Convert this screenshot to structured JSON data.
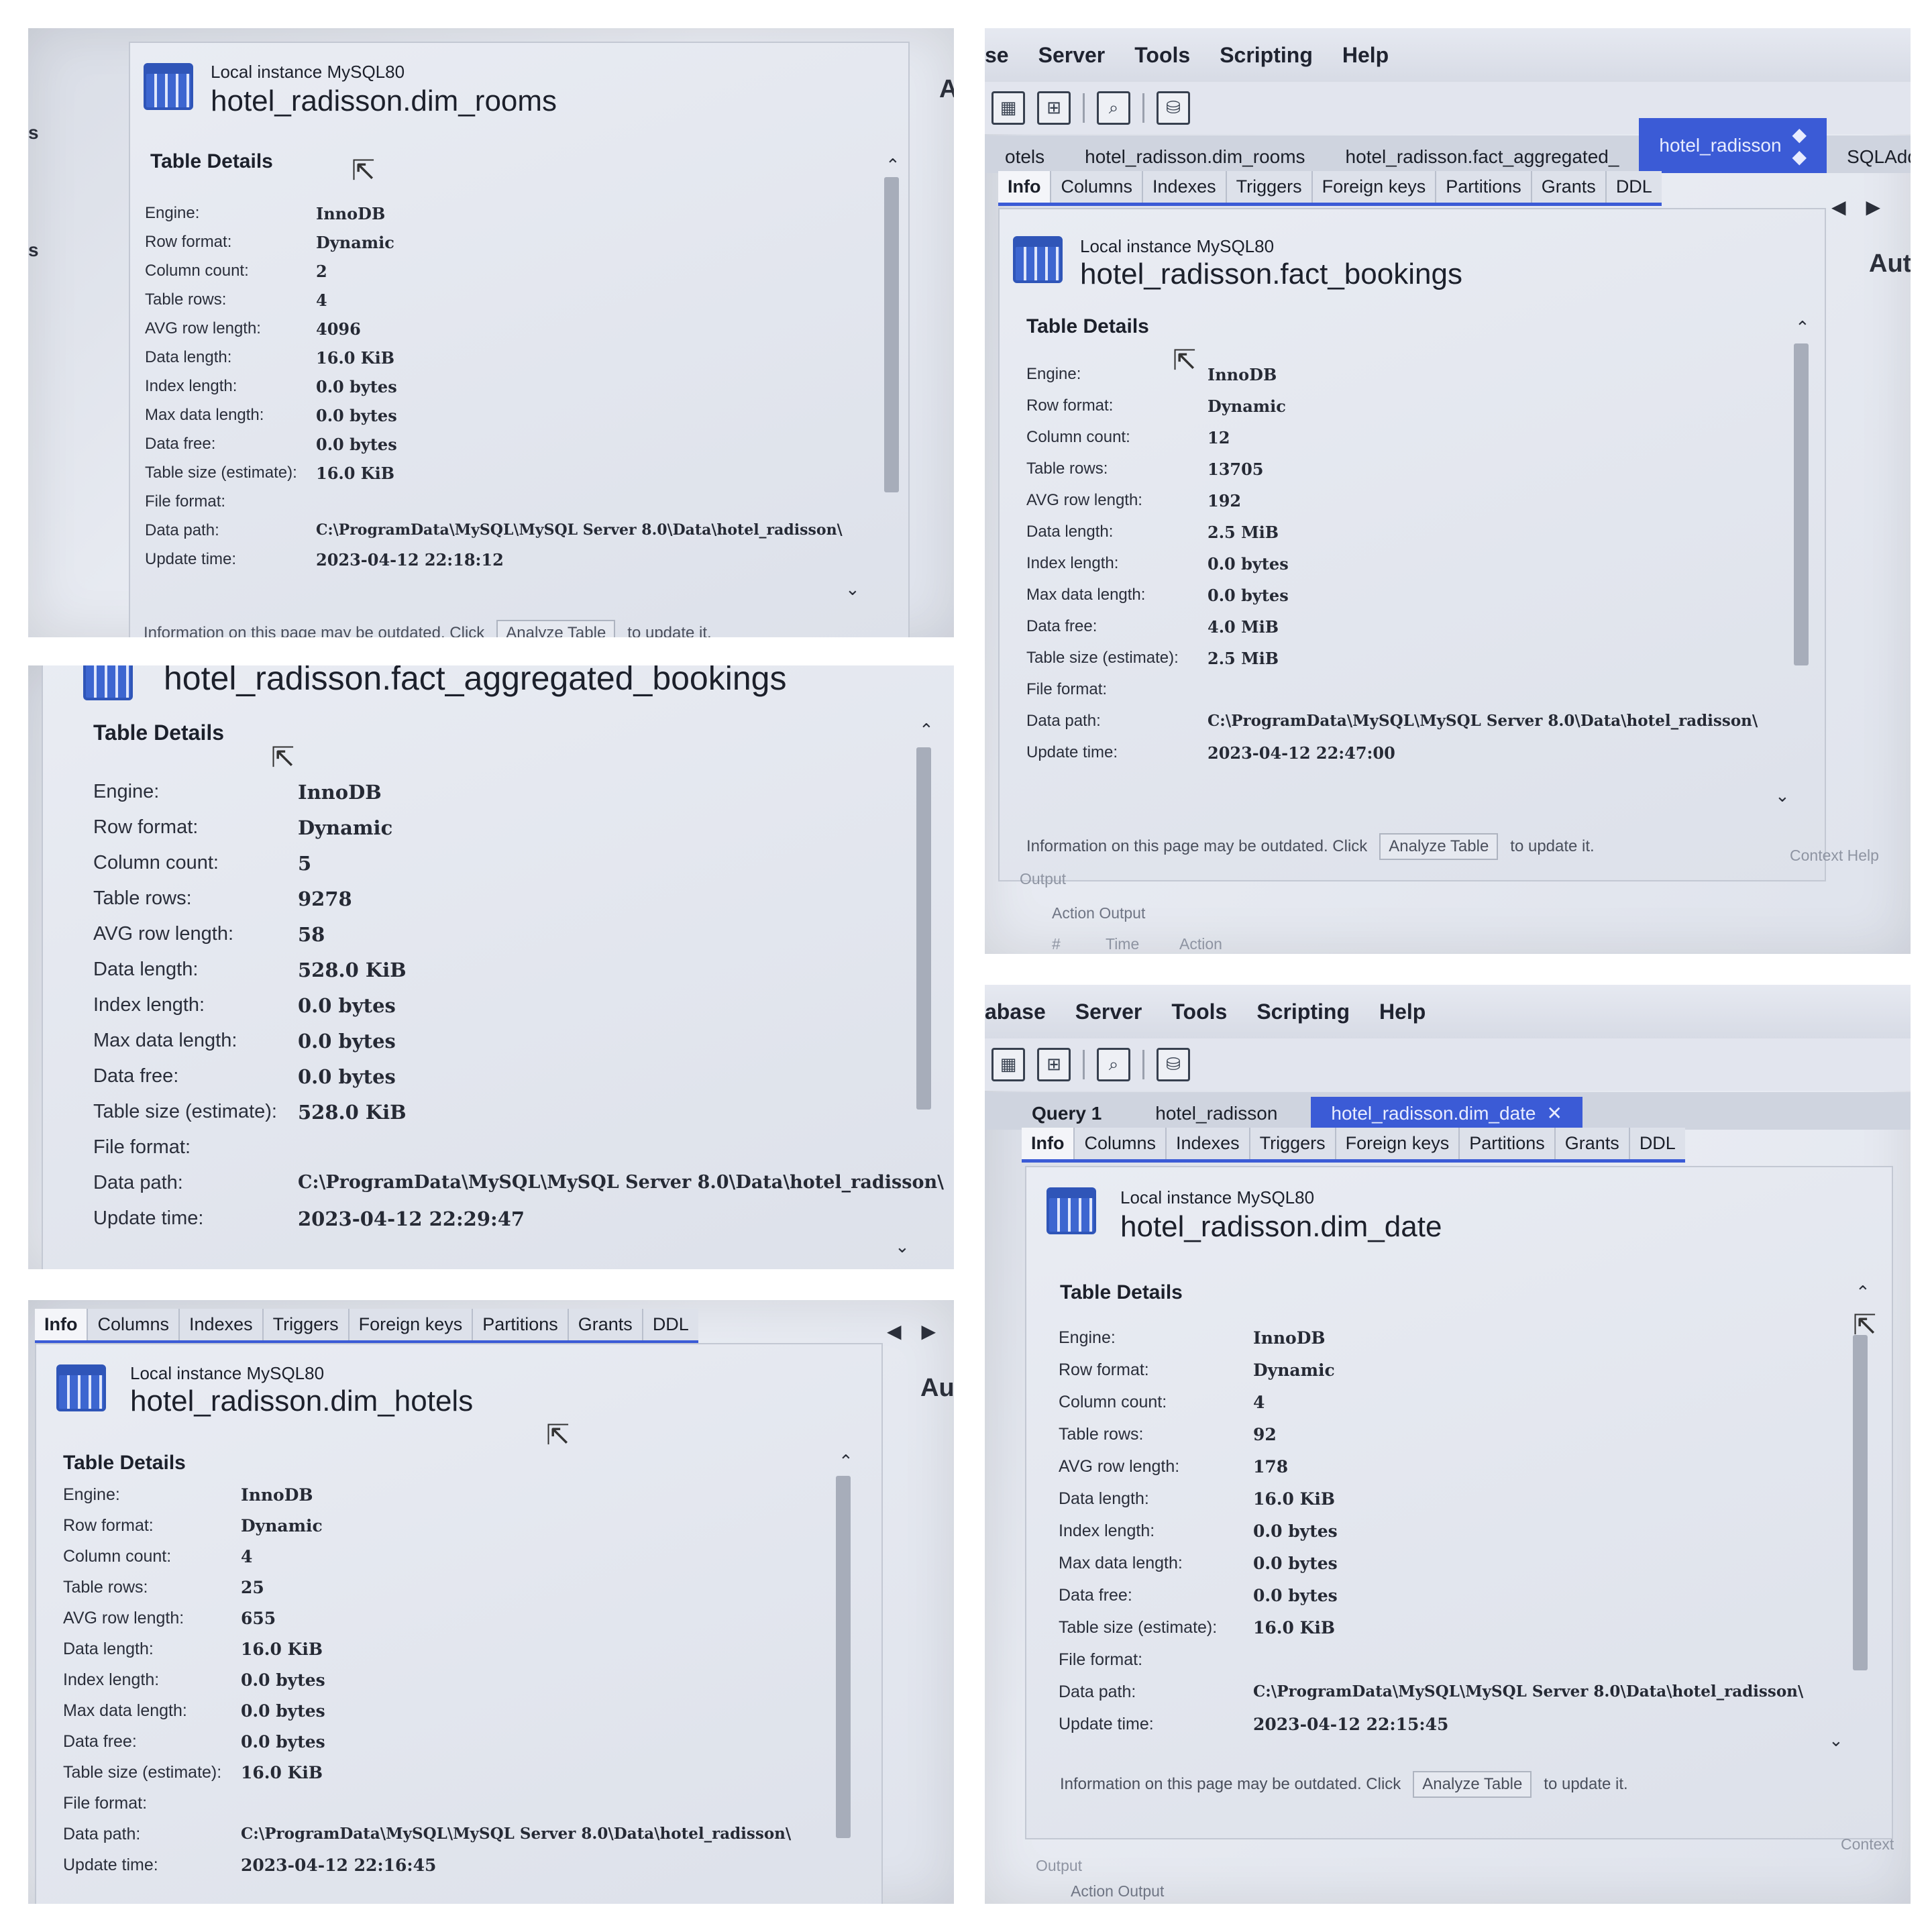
{
  "common": {
    "instance_label": "Local instance MySQL80",
    "section_title": "Table Details",
    "labels": {
      "engine": "Engine:",
      "row_format": "Row format:",
      "column_count": "Column count:",
      "table_rows": "Table rows:",
      "avg_row_length": "AVG row length:",
      "data_length": "Data length:",
      "index_length": "Index length:",
      "max_data_length": "Max data length:",
      "data_free": "Data free:",
      "table_size": "Table size (estimate):",
      "file_format": "File format:",
      "data_path": "Data path:",
      "update_time": "Update time:"
    },
    "footer_text": "Information on this page may be outdated. Click",
    "analyze_button": "Analyze Table",
    "footer_suffix": "to update it.",
    "output_label": "Output",
    "action_output": "Action Output",
    "menu": {
      "database_partial": "abase",
      "database_partial_b": "se",
      "server": "Server",
      "tools": "Tools",
      "scripting": "Scripting",
      "help": "Help"
    },
    "subtabs": [
      "Info",
      "Columns",
      "Indexes",
      "Triggers",
      "Foreign keys",
      "Partitions",
      "Grants",
      "DDL"
    ],
    "toolbar_icons": [
      "new-sql-tab-icon",
      "open-sql-script-icon",
      "inspector-icon",
      "create-schema-icon"
    ],
    "accent_color": "#3b5bd6"
  },
  "photo_dim_rooms": {
    "table_name": "hotel_radisson.dim_rooms",
    "left_edge_1": "s",
    "left_edge_2": "s",
    "right_edge": "A",
    "engine": "InnoDB",
    "row_format": "Dynamic",
    "column_count": "2",
    "table_rows": "4",
    "avg_row_length": "4096",
    "data_length": "16.0 KiB",
    "index_length": "0.0 bytes",
    "max_data_length": "0.0 bytes",
    "data_free": "0.0 bytes",
    "table_size": "16.0 KiB",
    "file_format": "",
    "data_path": "C:\\ProgramData\\MySQL\\MySQL Server 8.0\\Data\\hotel_radisson\\",
    "update_time": "2023-04-12 22:18:12"
  },
  "photo_fact_bookings": {
    "doc_tabs": [
      "otels",
      "hotel_radisson.dim_rooms",
      "hotel_radisson.fact_aggregated_",
      "hotel_radisson"
    ],
    "side_label": "SQLAddi",
    "right_edge": "Aut",
    "table_name": "hotel_radisson.fact_bookings",
    "engine": "InnoDB",
    "row_format": "Dynamic",
    "column_count": "12",
    "table_rows": "13705",
    "avg_row_length": "192",
    "data_length": "2.5 MiB",
    "index_length": "0.0 bytes",
    "max_data_length": "0.0 bytes",
    "data_free": "4.0 MiB",
    "table_size": "2.5 MiB",
    "file_format": "",
    "data_path": "C:\\ProgramData\\MySQL\\MySQL Server 8.0\\Data\\hotel_radisson\\",
    "update_time": "2023-04-12 22:47:00",
    "context_help": "Context Help",
    "output_cols": [
      "#",
      "Time",
      "Action"
    ]
  },
  "photo_fact_aggregated": {
    "table_name": "hotel_radisson.fact_aggregated_bookings",
    "engine": "InnoDB",
    "row_format": "Dynamic",
    "column_count": "5",
    "table_rows": "9278",
    "avg_row_length": "58",
    "data_length": "528.0 KiB",
    "index_length": "0.0 bytes",
    "max_data_length": "0.0 bytes",
    "data_free": "0.0 bytes",
    "table_size": "528.0 KiB",
    "file_format": "",
    "data_path": "C:\\ProgramData\\MySQL\\MySQL Server 8.0\\Data\\hotel_radisson\\",
    "update_time": "2023-04-12 22:29:47"
  },
  "photo_dim_hotels": {
    "right_edge": "Au",
    "table_name": "hotel_radisson.dim_hotels",
    "engine": "InnoDB",
    "row_format": "Dynamic",
    "column_count": "4",
    "table_rows": "25",
    "avg_row_length": "655",
    "data_length": "16.0 KiB",
    "index_length": "0.0 bytes",
    "max_data_length": "0.0 bytes",
    "data_free": "0.0 bytes",
    "table_size": "16.0 KiB",
    "file_format": "",
    "data_path": "C:\\ProgramData\\MySQL\\MySQL Server 8.0\\Data\\hotel_radisson\\",
    "update_time": "2023-04-12 22:16:45"
  },
  "photo_dim_date": {
    "doc_tabs": [
      "Query 1",
      "hotel_radisson",
      "hotel_radisson.dim_date"
    ],
    "table_name": "hotel_radisson.dim_date",
    "engine": "InnoDB",
    "row_format": "Dynamic",
    "column_count": "4",
    "table_rows": "92",
    "avg_row_length": "178",
    "data_length": "16.0 KiB",
    "index_length": "0.0 bytes",
    "max_data_length": "0.0 bytes",
    "data_free": "0.0 bytes",
    "table_size": "16.0 KiB",
    "file_format": "",
    "data_path": "C:\\ProgramData\\MySQL\\MySQL Server 8.0\\Data\\hotel_radisson\\",
    "update_time": "2023-04-12 22:15:45",
    "context_label": "Context"
  }
}
